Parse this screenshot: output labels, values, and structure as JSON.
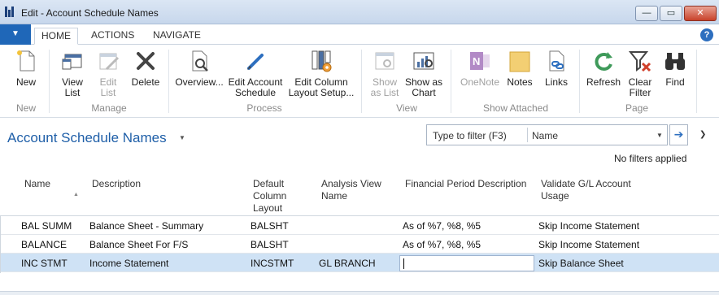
{
  "window": {
    "title": "Edit - Account Schedule Names",
    "minimize_glyph": "—",
    "maximize_glyph": "▭",
    "close_glyph": "✕"
  },
  "ribbon_tabs": {
    "app_menu_glyph": "▼",
    "tabs": [
      "HOME",
      "ACTIONS",
      "NAVIGATE"
    ],
    "help_glyph": "?"
  },
  "ribbon": {
    "new": {
      "label": "New"
    },
    "view_list": {
      "line1": "View",
      "line2": "List"
    },
    "edit_list": {
      "line1": "Edit",
      "line2": "List"
    },
    "delete": {
      "label": "Delete"
    },
    "overview": {
      "label": "Overview..."
    },
    "edit_account_schedule": {
      "line1": "Edit Account",
      "line2": "Schedule"
    },
    "edit_column_layout_setup": {
      "line1": "Edit Column",
      "line2": "Layout Setup..."
    },
    "show_as_list": {
      "line1": "Show",
      "line2": "as List"
    },
    "show_as_chart": {
      "line1": "Show as",
      "line2": "Chart"
    },
    "onenote": {
      "label": "OneNote"
    },
    "notes": {
      "label": "Notes"
    },
    "links": {
      "label": "Links"
    },
    "refresh": {
      "label": "Refresh"
    },
    "clear_filter": {
      "line1": "Clear",
      "line2": "Filter"
    },
    "find": {
      "label": "Find"
    },
    "groups": {
      "new": "New",
      "manage": "Manage",
      "process": "Process",
      "view": "View",
      "show_attached": "Show Attached",
      "page": "Page"
    }
  },
  "page": {
    "title": "Account Schedule Names",
    "filter_placeholder": "Type to filter (F3)",
    "filter_field": "Name",
    "no_filters": "No filters applied"
  },
  "grid": {
    "headers": {
      "name": "Name",
      "description": "Description",
      "default_column_layout": [
        "Default",
        "Column",
        "Layout"
      ],
      "analysis_view_name": [
        "Analysis View",
        "Name"
      ],
      "financial_period_description": "Financial Period Description",
      "validate_gl_account_usage": [
        "Validate G/L Account",
        "Usage"
      ]
    },
    "rows": [
      {
        "name": "BAL SUMM",
        "description": "Balance Sheet - Summary",
        "default_column_layout": "BALSHT",
        "analysis_view_name": "",
        "financial_period_description": "As of %7, %8, %5",
        "validate_gl_account_usage": "Skip Income Statement"
      },
      {
        "name": "BALANCE",
        "description": "Balance Sheet For F/S",
        "default_column_layout": "BALSHT",
        "analysis_view_name": "",
        "financial_period_description": "As of %7, %8, %5",
        "validate_gl_account_usage": "Skip Income Statement"
      },
      {
        "name": "INC STMT",
        "description": "Income Statement",
        "default_column_layout": "INCSTMT",
        "analysis_view_name": "GL BRANCH",
        "financial_period_description": "",
        "validate_gl_account_usage": "Skip Balance Sheet"
      }
    ]
  },
  "colors": {
    "accent_blue": "#1f5fa8",
    "app_menu_blue": "#1f67b8",
    "selected_row": "#cfe2f5"
  }
}
